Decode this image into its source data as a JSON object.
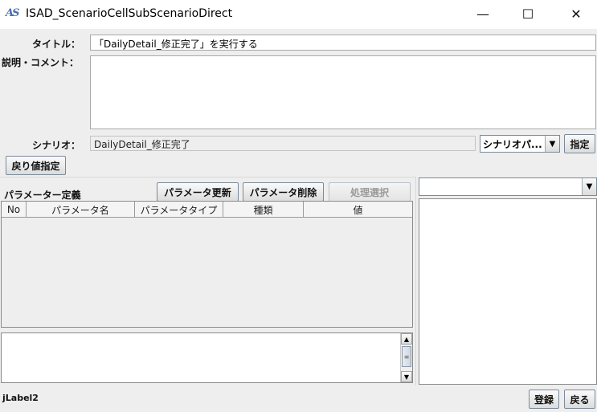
{
  "window": {
    "app_icon_text": "AS",
    "title": "ISAD_ScenarioCellSubScenarioDirect",
    "minimize_glyph": "—",
    "maximize_glyph": "☐",
    "close_glyph": "✕"
  },
  "form": {
    "title_label": "タイトル：",
    "title_value": "「DailyDetail_修正完了」を実行する",
    "comment_label": "説明・コメント：",
    "comment_value": "",
    "scenario_label": "シナリオ：",
    "scenario_value": "DailyDetail_修正完了",
    "scenario_combo_value": "シナリオパ...",
    "specify_button": "指定",
    "return_value_button": "戻り値指定"
  },
  "parameters": {
    "section_label": "パラメーター定義",
    "update_button": "パラメータ更新",
    "delete_button": "パラメータ削除",
    "select_button": "処理選択",
    "columns": [
      "No",
      "パラメータ名",
      "パラメータタイプ",
      "種類",
      "値"
    ],
    "rows": []
  },
  "right_panel": {
    "combo_value": ""
  },
  "footer": {
    "status_label": "jLabel2",
    "register_button": "登録",
    "back_button": "戻る"
  },
  "colors": {
    "client_background": "#eeeeee",
    "button_border": "#7a8a99",
    "field_border": "#a9a9a9"
  }
}
